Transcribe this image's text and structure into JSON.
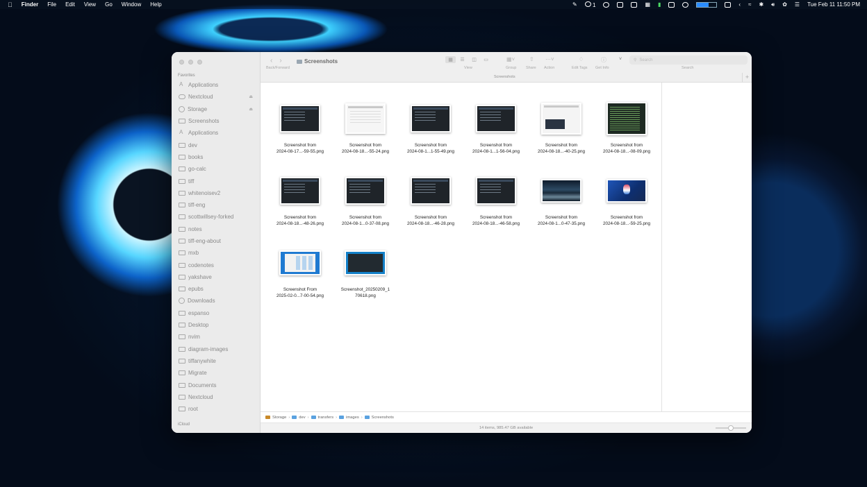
{
  "menubar": {
    "app_name": "Finder",
    "menus": [
      "File",
      "Edit",
      "View",
      "Go",
      "Window",
      "Help"
    ],
    "status_count": "1",
    "datetime": "Tue Feb 11  11:50 PM"
  },
  "window": {
    "title": "Screenshots",
    "toolbar": {
      "back_forward_label": "Back/Forward",
      "view_label": "View",
      "group_label": "Group",
      "share_label": "Share",
      "action_label": "Action",
      "edit_tags_label": "Edit Tags",
      "get_info_label": "Get Info",
      "search_label": "Search",
      "search_placeholder": "Search",
      "path_title": "Screenshots"
    },
    "sidebar": {
      "favorites_header": "Favorites",
      "icloud_header": "iCloud",
      "items": [
        {
          "label": "Applications",
          "icon": "app"
        },
        {
          "label": "Nextcloud",
          "icon": "cloud",
          "eject": true
        },
        {
          "label": "Storage",
          "icon": "disk",
          "eject": true
        },
        {
          "label": "Screenshots",
          "icon": "folder"
        },
        {
          "label": "Applications",
          "icon": "app"
        },
        {
          "label": "dev",
          "icon": "folder"
        },
        {
          "label": "books",
          "icon": "folder"
        },
        {
          "label": "go-calc",
          "icon": "folder"
        },
        {
          "label": "tiff",
          "icon": "folder"
        },
        {
          "label": "whitenoisev2",
          "icon": "folder"
        },
        {
          "label": "tiff-eng",
          "icon": "folder"
        },
        {
          "label": "scottwillsey-forked",
          "icon": "folder"
        },
        {
          "label": "notes",
          "icon": "folder"
        },
        {
          "label": "tiff-eng-about",
          "icon": "folder"
        },
        {
          "label": "mxb",
          "icon": "folder"
        },
        {
          "label": "codenotes",
          "icon": "folder"
        },
        {
          "label": "yakshave",
          "icon": "folder"
        },
        {
          "label": "epubs",
          "icon": "folder"
        },
        {
          "label": "Downloads",
          "icon": "download"
        },
        {
          "label": "espanso",
          "icon": "folder"
        },
        {
          "label": "Desktop",
          "icon": "folder"
        },
        {
          "label": "nvim",
          "icon": "folder"
        },
        {
          "label": "diagram-images",
          "icon": "folder"
        },
        {
          "label": "tiffanywhite",
          "icon": "folder"
        },
        {
          "label": "Migrate",
          "icon": "folder"
        },
        {
          "label": "Documents",
          "icon": "folder"
        },
        {
          "label": "Nextcloud",
          "icon": "folder"
        },
        {
          "label": "root",
          "icon": "folder"
        }
      ]
    },
    "files": [
      {
        "line1": "Screenshot from",
        "line2": "2024-08-17...-59-55.png",
        "style": "dark"
      },
      {
        "line1": "Screenshot from",
        "line2": "2024-08-18...-55-24.png",
        "style": "light"
      },
      {
        "line1": "Screenshot from",
        "line2": "2024-08-1...1-55-49.png",
        "style": "dark"
      },
      {
        "line1": "Screenshot from",
        "line2": "2024-08-1...1-56-04.png",
        "style": "dark"
      },
      {
        "line1": "Screenshot from",
        "line2": "2024-08-18...-40-25.png",
        "style": "mixed"
      },
      {
        "line1": "Screenshot from",
        "line2": "2024-08-18...-08-09.png",
        "style": "code"
      },
      {
        "line1": "Screenshot from",
        "line2": "2024-08-18...-48-26.png",
        "style": "dark"
      },
      {
        "line1": "Screenshot from",
        "line2": "2024-08-1...0-37-08.png",
        "style": "dark"
      },
      {
        "line1": "Screenshot from",
        "line2": "2024-08-18...-46-28.png",
        "style": "dark"
      },
      {
        "line1": "Screenshot from",
        "line2": "2024-08-18...-46-58.png",
        "style": "dark"
      },
      {
        "line1": "Screenshot from",
        "line2": "2024-08-1...0-47-35.png",
        "style": "land"
      },
      {
        "line1": "Screenshot from",
        "line2": "2024-08-18...-59-25.png",
        "style": "blue"
      },
      {
        "line1": "Screenshot From",
        "line2": "2025-02-0...7-00-54.png",
        "style": "finder"
      },
      {
        "line1": "Screenshot_20250209_1",
        "line2": "70618.png",
        "style": "term"
      }
    ],
    "pathbar": [
      "Storage",
      "dev",
      "transfers",
      "images",
      "Screenshots"
    ],
    "status": "14 items, 985.47 GB available"
  }
}
